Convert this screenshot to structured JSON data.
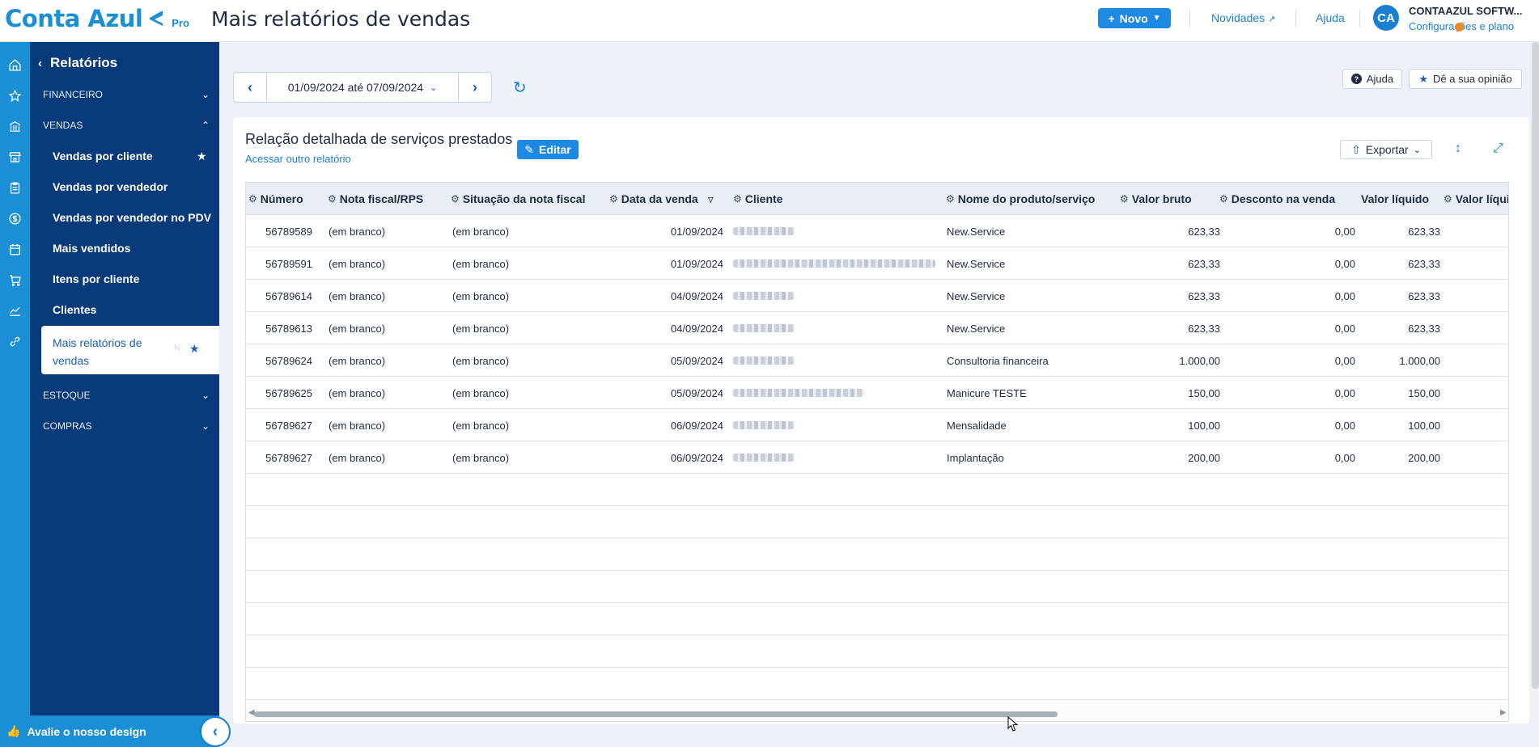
{
  "header": {
    "logo_text": "Conta Azul",
    "logo_tier": "Pro",
    "page_title": "Mais relatórios de vendas",
    "new_button": "Novo",
    "news_link": "Novidades",
    "help_link": "Ajuda",
    "avatar_initials": "CA",
    "company_name": "CONTAAZUL SOFTW...",
    "company_sub": "Configurações e plano"
  },
  "sidebar": {
    "title": "Relatórios",
    "sections": {
      "financeiro": "FINANCEIRO",
      "vendas": "VENDAS",
      "estoque": "ESTOQUE",
      "compras": "COMPRAS"
    },
    "items": [
      {
        "label": "Vendas por cliente"
      },
      {
        "label": "Vendas por vendedor"
      },
      {
        "label": "Vendas por vendedor no PDV"
      },
      {
        "label": "Mais vendidos"
      },
      {
        "label": "Itens por cliente"
      },
      {
        "label": "Clientes"
      },
      {
        "label": "Mais relatórios de vendas"
      }
    ],
    "active_badge": "N",
    "footer": "Avalie o nosso design"
  },
  "toolbar": {
    "date_range": "01/09/2024 até 07/09/2024",
    "help_button": "Ajuda",
    "feedback_button": "Dê a sua opinião"
  },
  "report": {
    "title": "Relação detalhada de serviços prestados",
    "other_link": "Acessar outro relatório",
    "edit_button": "Editar",
    "export_button": "Exportar",
    "columns": [
      "Número",
      "Nota fiscal/RPS",
      "Situação da nota fiscal",
      "Data da venda",
      "Cliente",
      "Nome do produto/serviço",
      "Valor bruto",
      "Desconto na venda",
      "Valor líquido",
      "Valor líqui"
    ],
    "rows": [
      {
        "numero": "56789589",
        "nf": "(em branco)",
        "situacao": "(em branco)",
        "data": "01/09/2024",
        "produto": "New.Service",
        "bruto": "623,33",
        "desconto": "0,00",
        "liquido": "623,33"
      },
      {
        "numero": "56789591",
        "nf": "(em branco)",
        "situacao": "(em branco)",
        "data": "01/09/2024",
        "produto": "New.Service",
        "bruto": "623,33",
        "desconto": "0,00",
        "liquido": "623,33"
      },
      {
        "numero": "56789614",
        "nf": "(em branco)",
        "situacao": "(em branco)",
        "data": "04/09/2024",
        "produto": "New.Service",
        "bruto": "623,33",
        "desconto": "0,00",
        "liquido": "623,33"
      },
      {
        "numero": "56789613",
        "nf": "(em branco)",
        "situacao": "(em branco)",
        "data": "04/09/2024",
        "produto": "New.Service",
        "bruto": "623,33",
        "desconto": "0,00",
        "liquido": "623,33"
      },
      {
        "numero": "56789624",
        "nf": "(em branco)",
        "situacao": "(em branco)",
        "data": "05/09/2024",
        "produto": "Consultoria financeira",
        "bruto": "1.000,00",
        "desconto": "0,00",
        "liquido": "1.000,00"
      },
      {
        "numero": "56789625",
        "nf": "(em branco)",
        "situacao": "(em branco)",
        "data": "05/09/2024",
        "produto": "Manicure TESTE",
        "bruto": "150,00",
        "desconto": "0,00",
        "liquido": "150,00"
      },
      {
        "numero": "56789627",
        "nf": "(em branco)",
        "situacao": "(em branco)",
        "data": "06/09/2024",
        "produto": "Mensalidade",
        "bruto": "100,00",
        "desconto": "0,00",
        "liquido": "100,00"
      },
      {
        "numero": "56789627",
        "nf": "(em branco)",
        "situacao": "(em branco)",
        "data": "06/09/2024",
        "produto": "Implantação",
        "bruto": "200,00",
        "desconto": "0,00",
        "liquido": "200,00"
      }
    ]
  },
  "colors": {
    "brand": "#1a8fd6",
    "sidebar": "#063a7a",
    "primary_button": "#1e88e5"
  }
}
